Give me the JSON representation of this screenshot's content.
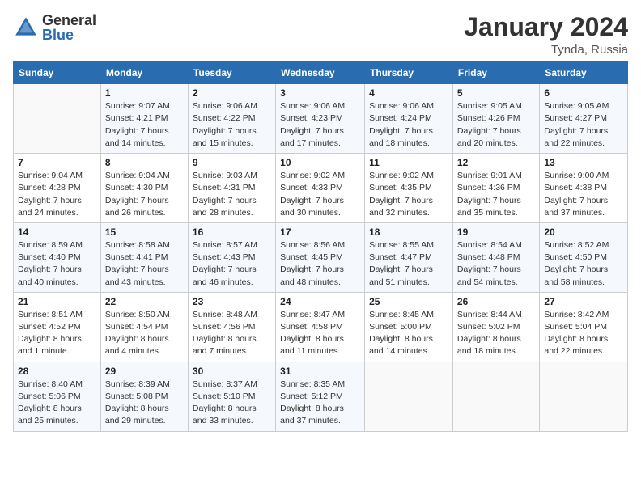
{
  "logo": {
    "general": "General",
    "blue": "Blue"
  },
  "header": {
    "month": "January 2024",
    "location": "Tynda, Russia"
  },
  "days_of_week": [
    "Sunday",
    "Monday",
    "Tuesday",
    "Wednesday",
    "Thursday",
    "Friday",
    "Saturday"
  ],
  "weeks": [
    [
      {
        "num": "",
        "sunrise": "",
        "sunset": "",
        "daylight": ""
      },
      {
        "num": "1",
        "sunrise": "Sunrise: 9:07 AM",
        "sunset": "Sunset: 4:21 PM",
        "daylight": "Daylight: 7 hours and 14 minutes."
      },
      {
        "num": "2",
        "sunrise": "Sunrise: 9:06 AM",
        "sunset": "Sunset: 4:22 PM",
        "daylight": "Daylight: 7 hours and 15 minutes."
      },
      {
        "num": "3",
        "sunrise": "Sunrise: 9:06 AM",
        "sunset": "Sunset: 4:23 PM",
        "daylight": "Daylight: 7 hours and 17 minutes."
      },
      {
        "num": "4",
        "sunrise": "Sunrise: 9:06 AM",
        "sunset": "Sunset: 4:24 PM",
        "daylight": "Daylight: 7 hours and 18 minutes."
      },
      {
        "num": "5",
        "sunrise": "Sunrise: 9:05 AM",
        "sunset": "Sunset: 4:26 PM",
        "daylight": "Daylight: 7 hours and 20 minutes."
      },
      {
        "num": "6",
        "sunrise": "Sunrise: 9:05 AM",
        "sunset": "Sunset: 4:27 PM",
        "daylight": "Daylight: 7 hours and 22 minutes."
      }
    ],
    [
      {
        "num": "7",
        "sunrise": "Sunrise: 9:04 AM",
        "sunset": "Sunset: 4:28 PM",
        "daylight": "Daylight: 7 hours and 24 minutes."
      },
      {
        "num": "8",
        "sunrise": "Sunrise: 9:04 AM",
        "sunset": "Sunset: 4:30 PM",
        "daylight": "Daylight: 7 hours and 26 minutes."
      },
      {
        "num": "9",
        "sunrise": "Sunrise: 9:03 AM",
        "sunset": "Sunset: 4:31 PM",
        "daylight": "Daylight: 7 hours and 28 minutes."
      },
      {
        "num": "10",
        "sunrise": "Sunrise: 9:02 AM",
        "sunset": "Sunset: 4:33 PM",
        "daylight": "Daylight: 7 hours and 30 minutes."
      },
      {
        "num": "11",
        "sunrise": "Sunrise: 9:02 AM",
        "sunset": "Sunset: 4:35 PM",
        "daylight": "Daylight: 7 hours and 32 minutes."
      },
      {
        "num": "12",
        "sunrise": "Sunrise: 9:01 AM",
        "sunset": "Sunset: 4:36 PM",
        "daylight": "Daylight: 7 hours and 35 minutes."
      },
      {
        "num": "13",
        "sunrise": "Sunrise: 9:00 AM",
        "sunset": "Sunset: 4:38 PM",
        "daylight": "Daylight: 7 hours and 37 minutes."
      }
    ],
    [
      {
        "num": "14",
        "sunrise": "Sunrise: 8:59 AM",
        "sunset": "Sunset: 4:40 PM",
        "daylight": "Daylight: 7 hours and 40 minutes."
      },
      {
        "num": "15",
        "sunrise": "Sunrise: 8:58 AM",
        "sunset": "Sunset: 4:41 PM",
        "daylight": "Daylight: 7 hours and 43 minutes."
      },
      {
        "num": "16",
        "sunrise": "Sunrise: 8:57 AM",
        "sunset": "Sunset: 4:43 PM",
        "daylight": "Daylight: 7 hours and 46 minutes."
      },
      {
        "num": "17",
        "sunrise": "Sunrise: 8:56 AM",
        "sunset": "Sunset: 4:45 PM",
        "daylight": "Daylight: 7 hours and 48 minutes."
      },
      {
        "num": "18",
        "sunrise": "Sunrise: 8:55 AM",
        "sunset": "Sunset: 4:47 PM",
        "daylight": "Daylight: 7 hours and 51 minutes."
      },
      {
        "num": "19",
        "sunrise": "Sunrise: 8:54 AM",
        "sunset": "Sunset: 4:48 PM",
        "daylight": "Daylight: 7 hours and 54 minutes."
      },
      {
        "num": "20",
        "sunrise": "Sunrise: 8:52 AM",
        "sunset": "Sunset: 4:50 PM",
        "daylight": "Daylight: 7 hours and 58 minutes."
      }
    ],
    [
      {
        "num": "21",
        "sunrise": "Sunrise: 8:51 AM",
        "sunset": "Sunset: 4:52 PM",
        "daylight": "Daylight: 8 hours and 1 minute."
      },
      {
        "num": "22",
        "sunrise": "Sunrise: 8:50 AM",
        "sunset": "Sunset: 4:54 PM",
        "daylight": "Daylight: 8 hours and 4 minutes."
      },
      {
        "num": "23",
        "sunrise": "Sunrise: 8:48 AM",
        "sunset": "Sunset: 4:56 PM",
        "daylight": "Daylight: 8 hours and 7 minutes."
      },
      {
        "num": "24",
        "sunrise": "Sunrise: 8:47 AM",
        "sunset": "Sunset: 4:58 PM",
        "daylight": "Daylight: 8 hours and 11 minutes."
      },
      {
        "num": "25",
        "sunrise": "Sunrise: 8:45 AM",
        "sunset": "Sunset: 5:00 PM",
        "daylight": "Daylight: 8 hours and 14 minutes."
      },
      {
        "num": "26",
        "sunrise": "Sunrise: 8:44 AM",
        "sunset": "Sunset: 5:02 PM",
        "daylight": "Daylight: 8 hours and 18 minutes."
      },
      {
        "num": "27",
        "sunrise": "Sunrise: 8:42 AM",
        "sunset": "Sunset: 5:04 PM",
        "daylight": "Daylight: 8 hours and 22 minutes."
      }
    ],
    [
      {
        "num": "28",
        "sunrise": "Sunrise: 8:40 AM",
        "sunset": "Sunset: 5:06 PM",
        "daylight": "Daylight: 8 hours and 25 minutes."
      },
      {
        "num": "29",
        "sunrise": "Sunrise: 8:39 AM",
        "sunset": "Sunset: 5:08 PM",
        "daylight": "Daylight: 8 hours and 29 minutes."
      },
      {
        "num": "30",
        "sunrise": "Sunrise: 8:37 AM",
        "sunset": "Sunset: 5:10 PM",
        "daylight": "Daylight: 8 hours and 33 minutes."
      },
      {
        "num": "31",
        "sunrise": "Sunrise: 8:35 AM",
        "sunset": "Sunset: 5:12 PM",
        "daylight": "Daylight: 8 hours and 37 minutes."
      },
      {
        "num": "",
        "sunrise": "",
        "sunset": "",
        "daylight": ""
      },
      {
        "num": "",
        "sunrise": "",
        "sunset": "",
        "daylight": ""
      },
      {
        "num": "",
        "sunrise": "",
        "sunset": "",
        "daylight": ""
      }
    ]
  ]
}
